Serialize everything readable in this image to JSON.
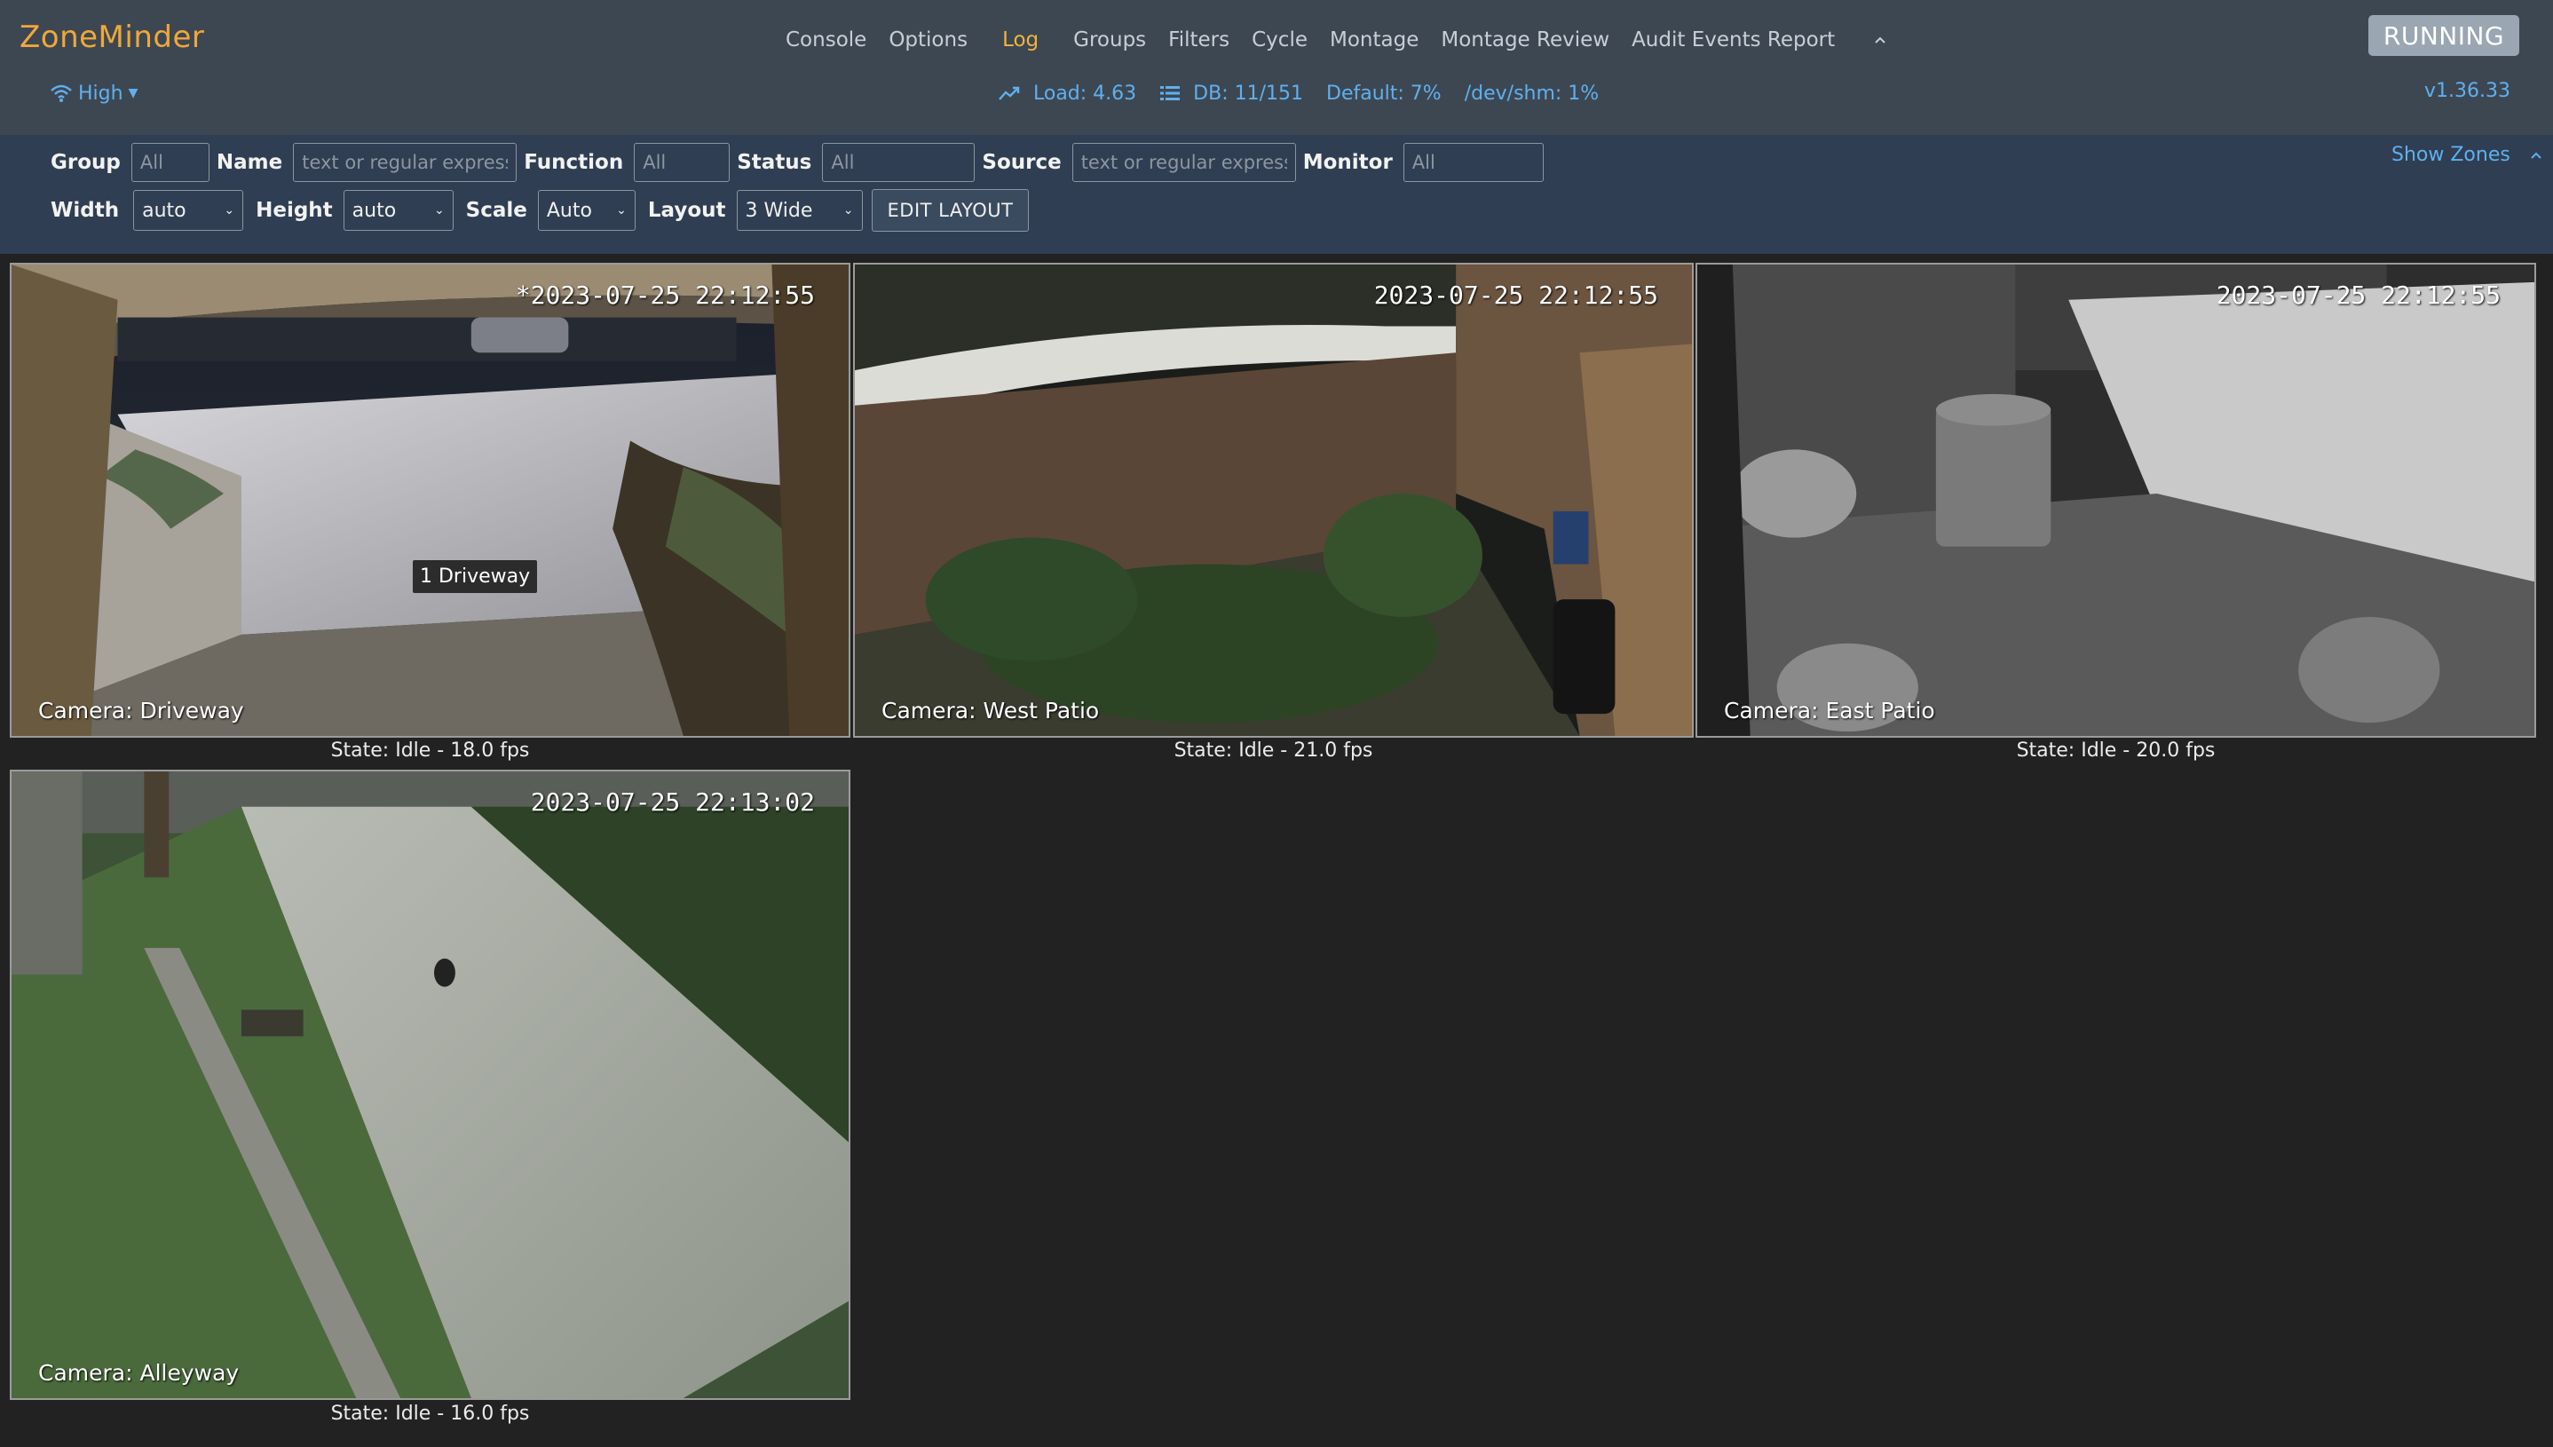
{
  "app": {
    "brand": "ZoneMinder",
    "status_button": "RUNNING",
    "version": "v1.36.33"
  },
  "nav": {
    "links": [
      "Console",
      "Options",
      "Log",
      "Groups",
      "Filters",
      "Cycle",
      "Montage",
      "Montage Review",
      "Audit Events Report"
    ],
    "active": "Log"
  },
  "bandwidth": {
    "label": "High"
  },
  "stats": {
    "load": "Load: 4.63",
    "db": "DB: 11/151",
    "default": "Default: 7%",
    "shm": "/dev/shm: 1%"
  },
  "filters": {
    "group": {
      "label": "Group",
      "placeholder": "All"
    },
    "name": {
      "label": "Name",
      "placeholder": "text or regular expression"
    },
    "function": {
      "label": "Function",
      "placeholder": "All"
    },
    "status": {
      "label": "Status",
      "placeholder": "All"
    },
    "source": {
      "label": "Source",
      "placeholder": "text or regular expression"
    },
    "monitor": {
      "label": "Monitor",
      "placeholder": "All"
    },
    "width": {
      "label": "Width",
      "value": "auto"
    },
    "height": {
      "label": "Height",
      "value": "auto"
    },
    "scale": {
      "label": "Scale",
      "value": "Auto"
    },
    "layout": {
      "label": "Layout",
      "value": "3 Wide"
    },
    "edit_layout": "EDIT LAYOUT",
    "show_zones": "Show Zones"
  },
  "monitors": [
    {
      "camera": "Camera: Driveway",
      "timestamp": "*2023-07-25 22:12:55",
      "state": "State: Idle - 18.0 fps",
      "hover_name": "1 Driveway"
    },
    {
      "camera": "Camera: West Patio",
      "timestamp": "2023-07-25 22:12:55",
      "state": "State: Idle - 21.0 fps"
    },
    {
      "camera": "Camera: East Patio",
      "timestamp": "2023-07-25 22:12:55",
      "state": "State: Idle - 20.0 fps"
    },
    {
      "camera": "Camera: Alleyway",
      "timestamp": "2023-07-25 22:13:02",
      "state": "State: Idle - 16.0 fps"
    }
  ],
  "colors": {
    "brand": "#f0a83a",
    "active_link": "#f0b43c",
    "link_blue": "#5fb0ee",
    "navbar_bg": "#3d4752",
    "filterbar_bg": "#2f3e52",
    "page_bg": "#222222"
  }
}
